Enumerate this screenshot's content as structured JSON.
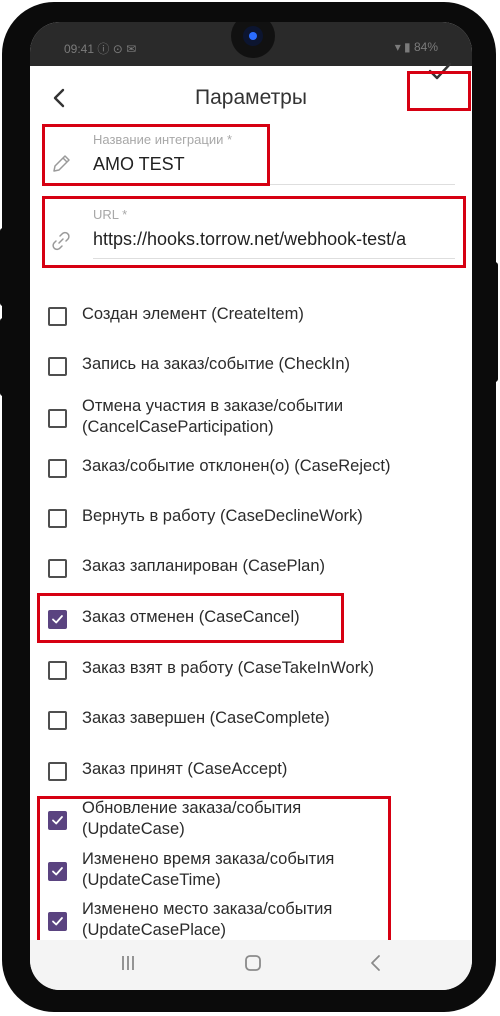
{
  "status_bar": {
    "left": "09:41 ⓘ ⊙ ✉",
    "right": "▾ ▮ 84%"
  },
  "header": {
    "title": "Параметры",
    "back_icon": "chevron-left-icon",
    "save_icon": "check-icon"
  },
  "form": {
    "name_field": {
      "label": "Название интеграции *",
      "value": "AMO TEST",
      "icon": "pencil-icon"
    },
    "url_field": {
      "label": "URL *",
      "value": "https://hooks.torrow.net/webhook-test/a",
      "icon": "link-icon"
    }
  },
  "events": [
    {
      "label": "Создан элемент (CreateItem)",
      "checked": false
    },
    {
      "label": "Запись на заказ/событие (CheckIn)",
      "checked": false
    },
    {
      "label": "Отмена участия в заказе/событии (CancelCaseParticipation)",
      "checked": false
    },
    {
      "label": "Заказ/событие отклонен(о) (CaseReject)",
      "checked": false
    },
    {
      "label": "Вернуть в работу (CaseDeclineWork)",
      "checked": false
    },
    {
      "label": "Заказ запланирован (CasePlan)",
      "checked": false
    },
    {
      "label": "Заказ отменен (CaseCancel)",
      "checked": true
    },
    {
      "label": "Заказ взят в работу (CaseTakeInWork)",
      "checked": false
    },
    {
      "label": "Заказ завершен (CaseComplete)",
      "checked": false
    },
    {
      "label": "Заказ принят (CaseAccept)",
      "checked": false
    },
    {
      "label": "Обновление заказа/события (UpdateCase)",
      "checked": true
    },
    {
      "label": "Изменено время заказа/события (UpdateCaseTime)",
      "checked": true
    },
    {
      "label": "Изменено место заказа/события (UpdateCasePlace)",
      "checked": true
    }
  ],
  "nav_bar": {
    "recents_icon": "recents-icon",
    "home_icon": "home-icon",
    "back_icon": "back-icon"
  },
  "colors": {
    "accent": "#5a4380",
    "highlight": "#d60012",
    "frame": "#0b0b0b"
  }
}
